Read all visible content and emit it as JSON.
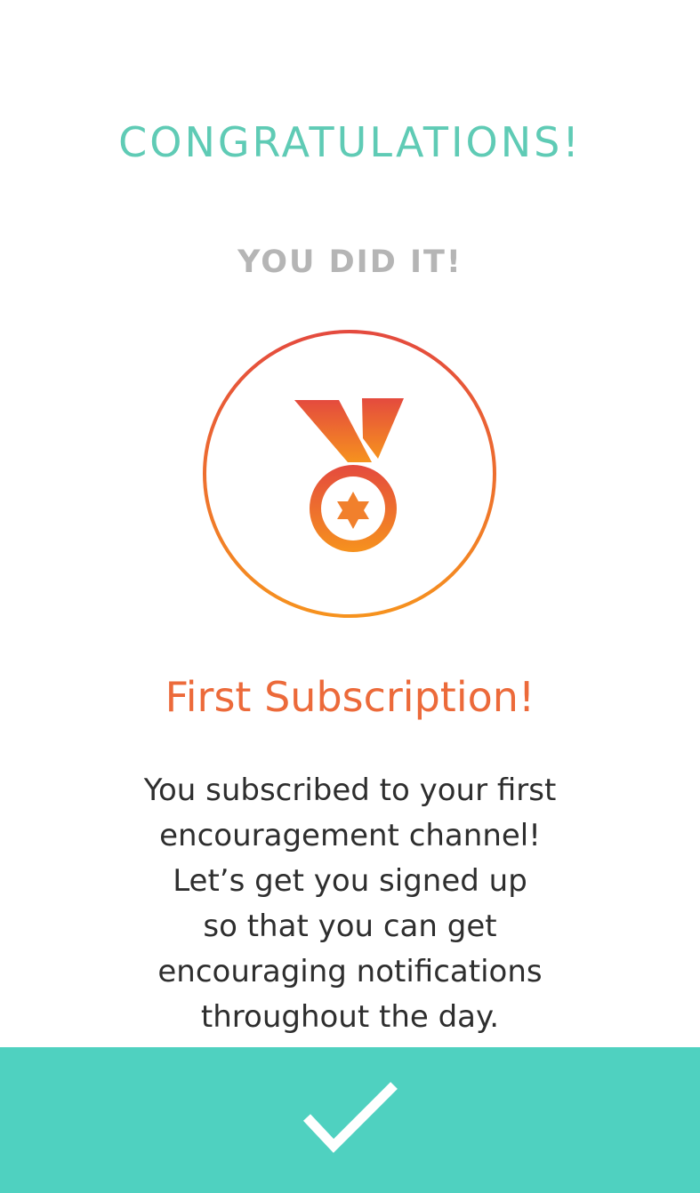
{
  "headline": "CONGRATULATIONS!",
  "subheadline": "YOU DID IT!",
  "badge": {
    "icon": "medal-icon",
    "gradient_top": "#e44a3e",
    "gradient_bottom": "#f6921e"
  },
  "achievement_title": "First Subscription!",
  "description_lines": [
    "You subscribed to your first",
    "encouragement channel!",
    "Let’s get you signed up",
    "so that you can get",
    "encouraging notifications",
    "throughout the day."
  ],
  "confirm": {
    "icon": "checkmark-icon",
    "color": "#4fd1c0"
  },
  "colors": {
    "headline": "#5fcbb5",
    "subheadline": "#b5b5b5",
    "title": "#ec6a3a",
    "body_text": "#2e2e2e"
  }
}
